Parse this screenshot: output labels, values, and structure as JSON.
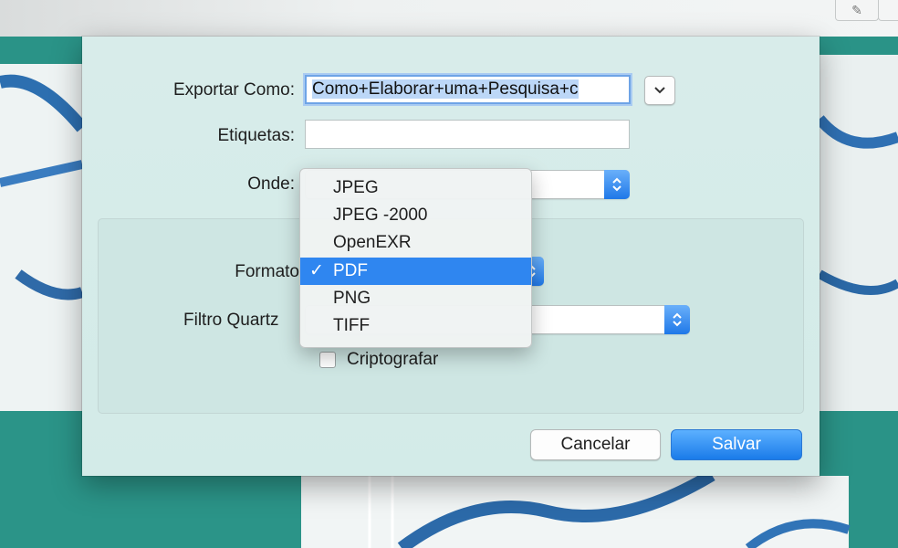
{
  "dialog": {
    "export_as_label": "Exportar Como:",
    "export_as_value": "Como+Elaborar+uma+Pesquisa+c",
    "tags_label": "Etiquetas:",
    "tags_value": "",
    "where_label": "Onde:",
    "format_label": "Formato",
    "quartz_filter_label": "Filtro Quartz",
    "encrypt_label": "Criptografar",
    "encrypt_checked": false,
    "cancel_label": "Cancelar",
    "save_label": "Salvar"
  },
  "format_menu": {
    "items": [
      {
        "label": "JPEG",
        "selected": false
      },
      {
        "label": "JPEG -2000",
        "selected": false
      },
      {
        "label": "OpenEXR",
        "selected": false
      },
      {
        "label": "PDF",
        "selected": true
      },
      {
        "label": "PNG",
        "selected": false
      },
      {
        "label": "TIFF",
        "selected": false
      }
    ],
    "check_glyph": "✓"
  },
  "colors": {
    "accent": "#2f86f0",
    "dialog_bg": "#d5ebe8",
    "background_teal": "#2a9387"
  },
  "icons": {
    "disclosure": "chevron-down-icon",
    "stepper": "up-down-chevron-icon",
    "toolbar": "pencil-icon"
  }
}
